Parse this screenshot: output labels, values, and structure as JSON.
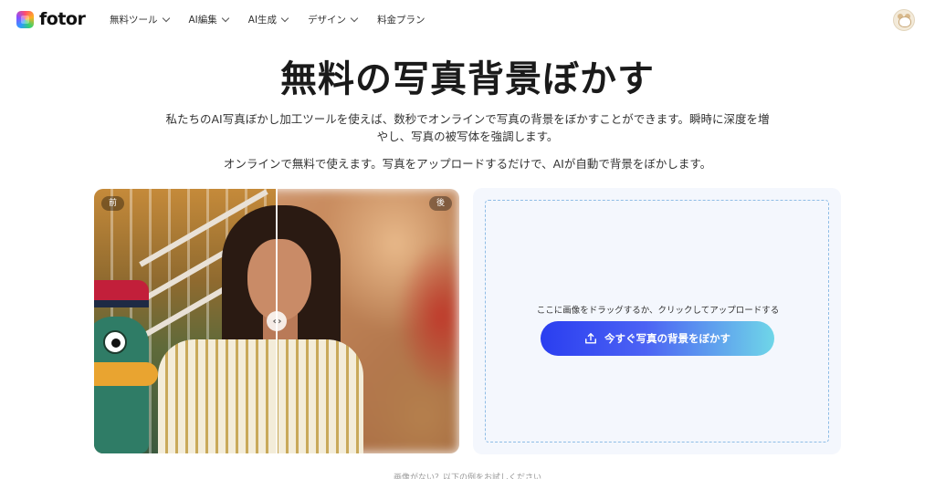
{
  "brand": {
    "name": "fotor"
  },
  "nav": {
    "items": [
      {
        "label": "無料ツール",
        "has_dropdown": true
      },
      {
        "label": "AI編集",
        "has_dropdown": true
      },
      {
        "label": "AI生成",
        "has_dropdown": true
      },
      {
        "label": "デザイン",
        "has_dropdown": true
      },
      {
        "label": "料金プラン",
        "has_dropdown": false
      }
    ]
  },
  "hero": {
    "title": "無料の写真背景ぼかす",
    "description": "私たちのAI写真ぼかし加工ツールを使えば、数秒でオンラインで写真の背景をぼかすことができます。瞬時に深度を増やし、写真の被写体を強調します。",
    "subtitle": "オンラインで無料で使えます。写真をアップロードするだけで、AIが自動で背景をぼかします。"
  },
  "compare": {
    "before_label": "前",
    "after_label": "後",
    "handle_glyph": "‹ ›"
  },
  "upload": {
    "hint": "ここに画像をドラッグするか、クリックしてアップロードする",
    "button_label": "今すぐ写真の背景をぼかす"
  },
  "icons": {
    "logo": "fotor-logo-icon",
    "upload": "upload-icon",
    "avatar": "user-avatar"
  },
  "colors": {
    "button_gradient_start": "#2a3ef0",
    "button_gradient_end": "#6fd6e8",
    "dropzone_border": "#8fbde6"
  },
  "footer": {
    "note": "画像がない？以下の例をお試しください"
  }
}
